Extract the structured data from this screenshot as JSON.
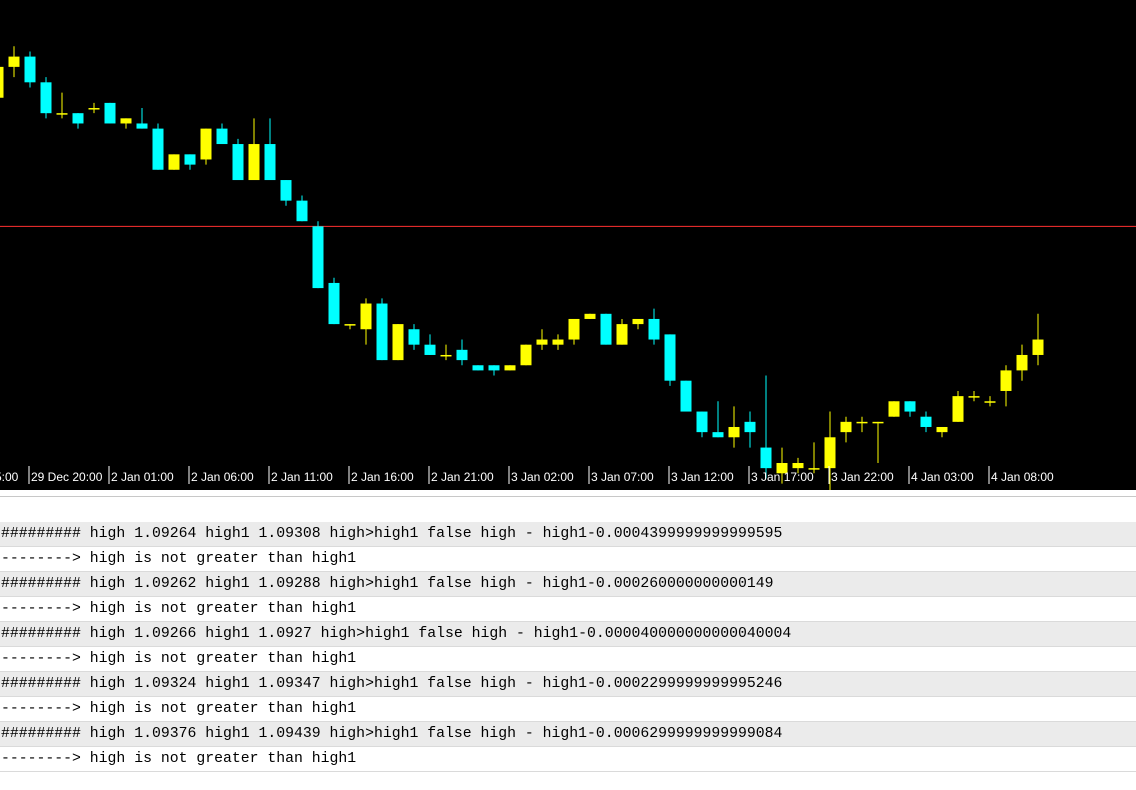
{
  "chart": {
    "background": "#000000",
    "bull_color": "#ffff00",
    "bear_color": "#00ffff",
    "level_line_color": "#ff3030",
    "level_price": 1.0933,
    "time_labels": [
      "5:00",
      "29 Dec 20:00",
      "2 Jan 01:00",
      "2 Jan 06:00",
      "2 Jan 11:00",
      "2 Jan 16:00",
      "2 Jan 21:00",
      "3 Jan 02:00",
      "3 Jan 07:00",
      "3 Jan 12:00",
      "3 Jan 17:00",
      "3 Jan 22:00",
      "4 Jan 03:00",
      "4 Jan 08:00"
    ]
  },
  "chart_data": {
    "type": "candlestick",
    "ylim": [
      1.0887,
      1.0977
    ],
    "candles": [
      {
        "o": 1.0958,
        "h": 1.0965,
        "l": 1.0958,
        "c": 1.0964
      },
      {
        "o": 1.0964,
        "h": 1.0968,
        "l": 1.0962,
        "c": 1.0966
      },
      {
        "o": 1.0966,
        "h": 1.0967,
        "l": 1.096,
        "c": 1.0961
      },
      {
        "o": 1.0961,
        "h": 1.0962,
        "l": 1.0954,
        "c": 1.0955
      },
      {
        "o": 1.0955,
        "h": 1.0959,
        "l": 1.0954,
        "c": 1.0955
      },
      {
        "o": 1.0955,
        "h": 1.0955,
        "l": 1.0952,
        "c": 1.0953
      },
      {
        "o": 1.0956,
        "h": 1.0957,
        "l": 1.0955,
        "c": 1.0956
      },
      {
        "o": 1.0957,
        "h": 1.0957,
        "l": 1.0953,
        "c": 1.0953
      },
      {
        "o": 1.0953,
        "h": 1.0954,
        "l": 1.0952,
        "c": 1.0954
      },
      {
        "o": 1.0953,
        "h": 1.0956,
        "l": 1.0952,
        "c": 1.0952
      },
      {
        "o": 1.0952,
        "h": 1.0953,
        "l": 1.0944,
        "c": 1.0944
      },
      {
        "o": 1.0944,
        "h": 1.0947,
        "l": 1.0944,
        "c": 1.0947
      },
      {
        "o": 1.0947,
        "h": 1.0947,
        "l": 1.0944,
        "c": 1.0945
      },
      {
        "o": 1.0946,
        "h": 1.0952,
        "l": 1.0945,
        "c": 1.0952
      },
      {
        "o": 1.0952,
        "h": 1.0953,
        "l": 1.0949,
        "c": 1.0949
      },
      {
        "o": 1.0949,
        "h": 1.095,
        "l": 1.0942,
        "c": 1.0942
      },
      {
        "o": 1.0942,
        "h": 1.0954,
        "l": 1.0942,
        "c": 1.0949
      },
      {
        "o": 1.0949,
        "h": 1.0954,
        "l": 1.0942,
        "c": 1.0942
      },
      {
        "o": 1.0942,
        "h": 1.0942,
        "l": 1.0937,
        "c": 1.0938
      },
      {
        "o": 1.0938,
        "h": 1.0939,
        "l": 1.0934,
        "c": 1.0934
      },
      {
        "o": 1.0933,
        "h": 1.0934,
        "l": 1.0921,
        "c": 1.0921
      },
      {
        "o": 1.0922,
        "h": 1.0923,
        "l": 1.0914,
        "c": 1.0914
      },
      {
        "o": 1.0914,
        "h": 1.0914,
        "l": 1.0913,
        "c": 1.0914
      },
      {
        "o": 1.0913,
        "h": 1.0919,
        "l": 1.091,
        "c": 1.0918
      },
      {
        "o": 1.0918,
        "h": 1.0919,
        "l": 1.0907,
        "c": 1.0907
      },
      {
        "o": 1.0907,
        "h": 1.0914,
        "l": 1.0907,
        "c": 1.0914
      },
      {
        "o": 1.0913,
        "h": 1.0914,
        "l": 1.0909,
        "c": 1.091
      },
      {
        "o": 1.091,
        "h": 1.0912,
        "l": 1.0908,
        "c": 1.0908
      },
      {
        "o": 1.0908,
        "h": 1.091,
        "l": 1.0907,
        "c": 1.0908
      },
      {
        "o": 1.0909,
        "h": 1.0911,
        "l": 1.0906,
        "c": 1.0907
      },
      {
        "o": 1.0906,
        "h": 1.0906,
        "l": 1.0905,
        "c": 1.0905
      },
      {
        "o": 1.0906,
        "h": 1.0906,
        "l": 1.0904,
        "c": 1.0905
      },
      {
        "o": 1.0905,
        "h": 1.0906,
        "l": 1.0905,
        "c": 1.0906
      },
      {
        "o": 1.0906,
        "h": 1.091,
        "l": 1.0906,
        "c": 1.091
      },
      {
        "o": 1.091,
        "h": 1.0913,
        "l": 1.0909,
        "c": 1.0911
      },
      {
        "o": 1.091,
        "h": 1.0912,
        "l": 1.0909,
        "c": 1.0911
      },
      {
        "o": 1.0911,
        "h": 1.0915,
        "l": 1.091,
        "c": 1.0915
      },
      {
        "o": 1.0915,
        "h": 1.0916,
        "l": 1.0915,
        "c": 1.0916
      },
      {
        "o": 1.0916,
        "h": 1.0916,
        "l": 1.091,
        "c": 1.091
      },
      {
        "o": 1.091,
        "h": 1.0915,
        "l": 1.091,
        "c": 1.0914
      },
      {
        "o": 1.0914,
        "h": 1.0915,
        "l": 1.0913,
        "c": 1.0915
      },
      {
        "o": 1.0915,
        "h": 1.0917,
        "l": 1.091,
        "c": 1.0911
      },
      {
        "o": 1.0912,
        "h": 1.0912,
        "l": 1.0902,
        "c": 1.0903
      },
      {
        "o": 1.0903,
        "h": 1.0903,
        "l": 1.0897,
        "c": 1.0897
      },
      {
        "o": 1.0897,
        "h": 1.0897,
        "l": 1.0892,
        "c": 1.0893
      },
      {
        "o": 1.0893,
        "h": 1.0899,
        "l": 1.0892,
        "c": 1.0892
      },
      {
        "o": 1.0892,
        "h": 1.0898,
        "l": 1.089,
        "c": 1.0894
      },
      {
        "o": 1.0895,
        "h": 1.0897,
        "l": 1.089,
        "c": 1.0893
      },
      {
        "o": 1.089,
        "h": 1.0904,
        "l": 1.0884,
        "c": 1.0886
      },
      {
        "o": 1.0885,
        "h": 1.089,
        "l": 1.0883,
        "c": 1.0887
      },
      {
        "o": 1.0886,
        "h": 1.0888,
        "l": 1.0885,
        "c": 1.0887
      },
      {
        "o": 1.0886,
        "h": 1.0891,
        "l": 1.0885,
        "c": 1.0886
      },
      {
        "o": 1.0886,
        "h": 1.0897,
        "l": 1.088,
        "c": 1.0892
      },
      {
        "o": 1.0893,
        "h": 1.0896,
        "l": 1.0891,
        "c": 1.0895
      },
      {
        "o": 1.0895,
        "h": 1.0896,
        "l": 1.0893,
        "c": 1.0895
      },
      {
        "o": 1.0895,
        "h": 1.0895,
        "l": 1.0887,
        "c": 1.0895
      },
      {
        "o": 1.0896,
        "h": 1.0899,
        "l": 1.0896,
        "c": 1.0899
      },
      {
        "o": 1.0899,
        "h": 1.0899,
        "l": 1.0896,
        "c": 1.0897
      },
      {
        "o": 1.0896,
        "h": 1.0897,
        "l": 1.0893,
        "c": 1.0894
      },
      {
        "o": 1.0893,
        "h": 1.0894,
        "l": 1.0892,
        "c": 1.0894
      },
      {
        "o": 1.0895,
        "h": 1.0901,
        "l": 1.0895,
        "c": 1.09
      },
      {
        "o": 1.09,
        "h": 1.0901,
        "l": 1.0899,
        "c": 1.09
      },
      {
        "o": 1.0899,
        "h": 1.09,
        "l": 1.0898,
        "c": 1.0899
      },
      {
        "o": 1.0901,
        "h": 1.0906,
        "l": 1.0898,
        "c": 1.0905
      },
      {
        "o": 1.0905,
        "h": 1.091,
        "l": 1.0903,
        "c": 1.0908
      },
      {
        "o": 1.0908,
        "h": 1.0916,
        "l": 1.0906,
        "c": 1.0911
      }
    ]
  },
  "log": [
    "######### high 1.09264 high1 1.09308 high>high1 false high - high1-0.0004399999999999595",
    "--------> high is not greater than high1",
    "######### high 1.09262 high1 1.09288 high>high1 false high - high1-0.000260000000000149",
    "--------> high is not greater than high1",
    "######### high 1.09266 high1 1.0927 high>high1 false high - high1-0.000040000000000040004",
    "--------> high is not greater than high1",
    "######### high 1.09324 high1 1.09347 high>high1 false high - high1-0.0002299999999995246",
    "--------> high is not greater than high1",
    "######### high 1.09376 high1 1.09439 high>high1 false high - high1-0.0006299999999999084",
    "--------> high is not greater than high1"
  ]
}
